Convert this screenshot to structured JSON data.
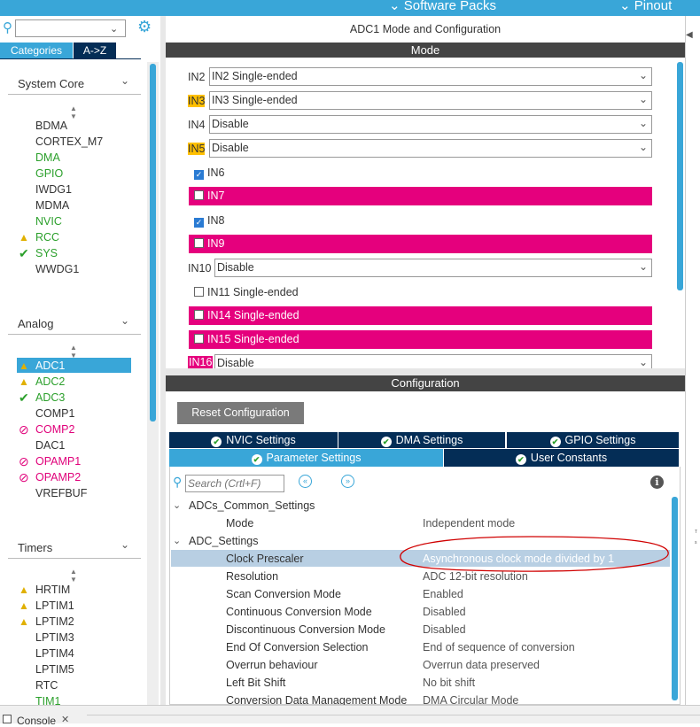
{
  "topbar": {
    "software_packs": "Software Packs",
    "pinout": "Pinout"
  },
  "left": {
    "tab_categories": "Categories",
    "tab_az": "A->Z",
    "system_core": {
      "title": "System Core",
      "items": [
        {
          "label": "BDMA",
          "status": ""
        },
        {
          "label": "CORTEX_M7",
          "status": ""
        },
        {
          "label": "DMA",
          "status": "green"
        },
        {
          "label": "GPIO",
          "status": "green"
        },
        {
          "label": "IWDG1",
          "status": ""
        },
        {
          "label": "MDMA",
          "status": ""
        },
        {
          "label": "NVIC",
          "status": "green"
        },
        {
          "label": "RCC",
          "status": "warning"
        },
        {
          "label": "SYS",
          "status": "ok"
        },
        {
          "label": "WWDG1",
          "status": ""
        }
      ]
    },
    "analog": {
      "title": "Analog",
      "items": [
        {
          "label": "ADC1",
          "status": "warning-selected"
        },
        {
          "label": "ADC2",
          "status": "warning"
        },
        {
          "label": "ADC3",
          "status": "ok"
        },
        {
          "label": "COMP1",
          "status": ""
        },
        {
          "label": "COMP2",
          "status": "disabled"
        },
        {
          "label": "DAC1",
          "status": ""
        },
        {
          "label": "OPAMP1",
          "status": "disabled"
        },
        {
          "label": "OPAMP2",
          "status": "disabled"
        },
        {
          "label": "VREFBUF",
          "status": ""
        }
      ]
    },
    "timers": {
      "title": "Timers",
      "items": [
        {
          "label": "HRTIM",
          "status": "warning"
        },
        {
          "label": "LPTIM1",
          "status": "warning"
        },
        {
          "label": "LPTIM2",
          "status": "warning"
        },
        {
          "label": "LPTIM3",
          "status": ""
        },
        {
          "label": "LPTIM4",
          "status": ""
        },
        {
          "label": "LPTIM5",
          "status": ""
        },
        {
          "label": "RTC",
          "status": ""
        },
        {
          "label": "TIM1",
          "status": "green"
        }
      ]
    }
  },
  "mode": {
    "panel_title": "ADC1 Mode and Configuration",
    "section_title": "Mode",
    "rows": {
      "in2": {
        "label": "IN2",
        "value": "IN2 Single-ended"
      },
      "in3": {
        "label": "IN3",
        "value": "IN3 Single-ended"
      },
      "in4": {
        "label": "IN4",
        "value": "Disable"
      },
      "in5": {
        "label": "IN5",
        "value": "Disable"
      },
      "in6": {
        "label": "IN6"
      },
      "in7": {
        "label": "IN7"
      },
      "in8": {
        "label": "IN8"
      },
      "in9": {
        "label": "IN9"
      },
      "in10": {
        "label": "IN10",
        "value": "Disable"
      },
      "in11": {
        "label": "IN11 Single-ended"
      },
      "in14": {
        "label": "IN14 Single-ended"
      },
      "in15": {
        "label": "IN15 Single-ended"
      },
      "in16": {
        "label": "IN16",
        "value": "Disable"
      }
    }
  },
  "config": {
    "section_title": "Configuration",
    "reset_button": "Reset Configuration",
    "tabs": {
      "nvic": "NVIC Settings",
      "dma": "DMA Settings",
      "gpio": "GPIO Settings",
      "param": "Parameter Settings",
      "user": "User Constants"
    },
    "search_placeholder": "Search (Crtl+F)",
    "groups": {
      "common": "ADCs_Common_Settings",
      "adc": "ADC_Settings"
    },
    "params": {
      "mode": {
        "name": "Mode",
        "value": "Independent mode"
      },
      "clock": {
        "name": "Clock Prescaler",
        "value": "Asynchronous clock mode divided by 1"
      },
      "resolution": {
        "name": "Resolution",
        "value": "ADC 12-bit resolution"
      },
      "scan": {
        "name": "Scan Conversion Mode",
        "value": "Enabled"
      },
      "continuous": {
        "name": "Continuous Conversion Mode",
        "value": "Disabled"
      },
      "discontinuous": {
        "name": "Discontinuous Conversion Mode",
        "value": "Disabled"
      },
      "eoc": {
        "name": "End Of Conversion Selection",
        "value": "End of sequence of conversion"
      },
      "overrun": {
        "name": "Overrun behaviour",
        "value": "Overrun data preserved"
      },
      "leftshift": {
        "name": "Left Bit Shift",
        "value": "No bit shift"
      },
      "cdm": {
        "name": "Conversion Data Management Mode",
        "value": "DMA Circular Mode"
      }
    }
  },
  "console": {
    "tab": "Console"
  },
  "colors": {
    "accent": "#39a6d8",
    "navy": "#042d56",
    "pink": "#e5007d",
    "highlight": "#ffc000",
    "annotation": "#d00000"
  }
}
